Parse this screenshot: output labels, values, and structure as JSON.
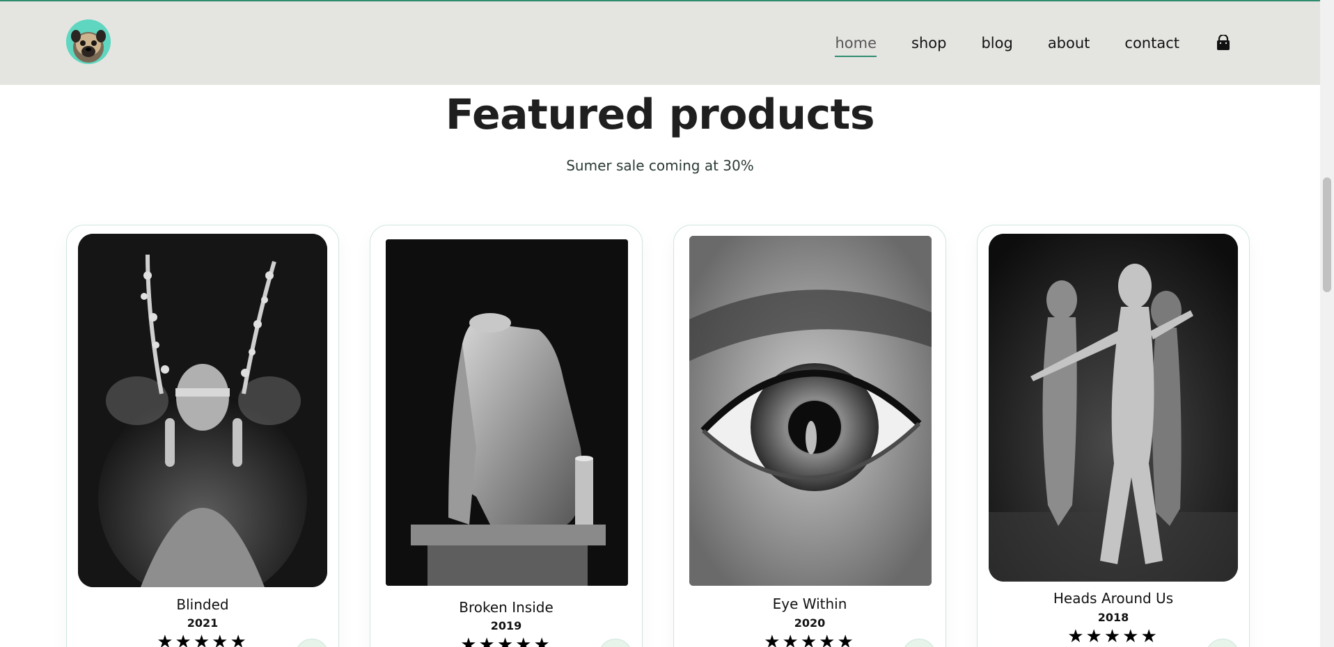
{
  "header": {
    "nav": [
      {
        "label": "home",
        "active": true
      },
      {
        "label": "shop",
        "active": false
      },
      {
        "label": "blog",
        "active": false
      },
      {
        "label": "about",
        "active": false
      },
      {
        "label": "contact",
        "active": false
      }
    ],
    "cart_icon": "shopping-bag-icon",
    "logo_icon": "pug-avatar-icon"
  },
  "section": {
    "title": "Featured products",
    "subtitle": "Sumer sale coming at 30%"
  },
  "products": [
    {
      "name": "Blinded",
      "year": "2021",
      "rating": 5,
      "rating_text": "★★★★★"
    },
    {
      "name": "Broken Inside",
      "year": "2019",
      "rating": 5,
      "rating_text": "★★★★★"
    },
    {
      "name": "Eye Within",
      "year": "2020",
      "rating": 5,
      "rating_text": "★★★★★"
    },
    {
      "name": "Heads Around Us",
      "year": "2018",
      "rating": 5,
      "rating_text": "★★★★★"
    }
  ],
  "colors": {
    "accent": "#2e8b6e",
    "header_bg": "#e4e5e1",
    "logo_bg": "#5ed6c0",
    "card_border": "#cfe6dd"
  }
}
